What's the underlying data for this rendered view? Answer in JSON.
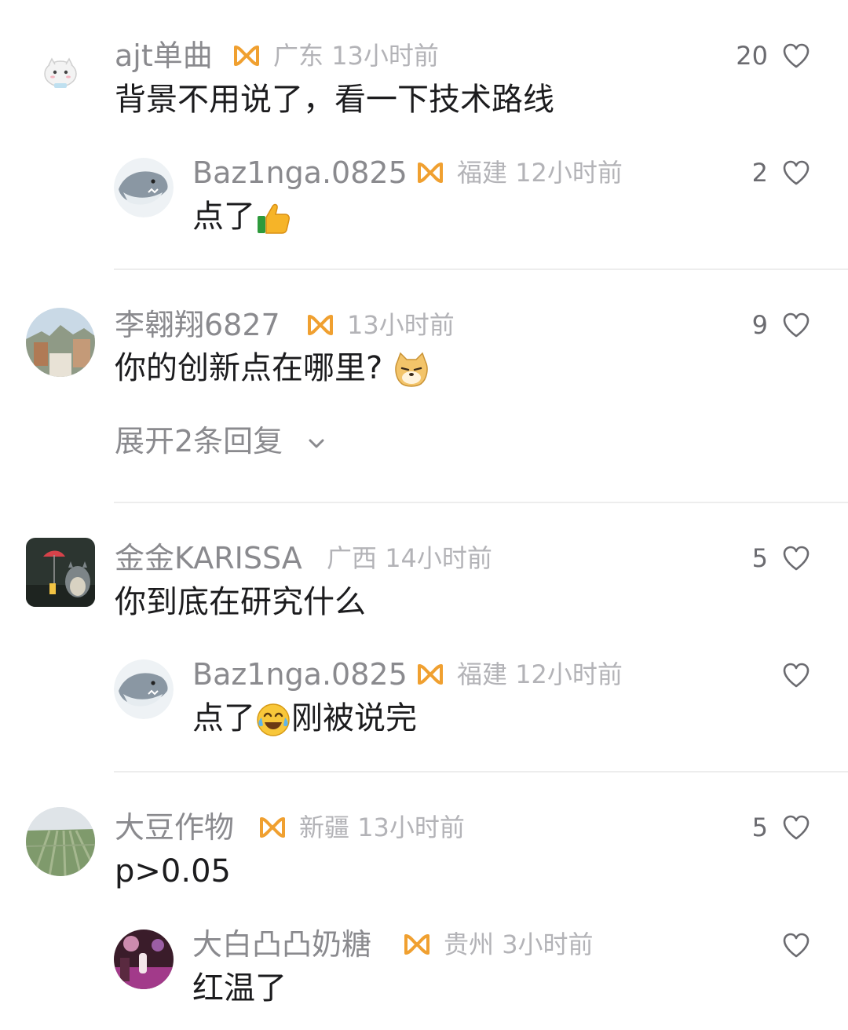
{
  "comments": [
    {
      "name": "ajt单曲",
      "region": "广东",
      "time": "13小时前",
      "text": "背景不用说了，看一下技术路线",
      "likes": "20",
      "reply": {
        "name": "Baz1nga.0825",
        "region": "福建",
        "time": "12小时前",
        "text": "点了",
        "likes": "2"
      }
    },
    {
      "name": "李翱翔6827",
      "region": "",
      "time": "13小时前",
      "text": "你的创新点在哪里?",
      "likes": "9",
      "expand_label": "展开2条回复"
    },
    {
      "name": "金金KARISSA",
      "region": "广西",
      "time": "14小时前",
      "text": "你到底在研究什么",
      "likes": "5",
      "reply": {
        "name": "Baz1nga.0825",
        "region": "福建",
        "time": "12小时前",
        "text_before": "点了",
        "text_after": "刚被说完",
        "likes": ""
      }
    },
    {
      "name": "大豆作物",
      "region": "新疆",
      "time": "13小时前",
      "text": "p>0.05",
      "likes": "5",
      "reply": {
        "name": "大白凸凸奶糖",
        "region": "贵州",
        "time": "3小时前",
        "text": "红温了",
        "likes": ""
      }
    }
  ],
  "colors": {
    "badge": "#f0a030",
    "username": "#8a8a8e",
    "meta": "#b3b3b7",
    "body_text": "#1c1c1e",
    "divider": "#ededed"
  }
}
